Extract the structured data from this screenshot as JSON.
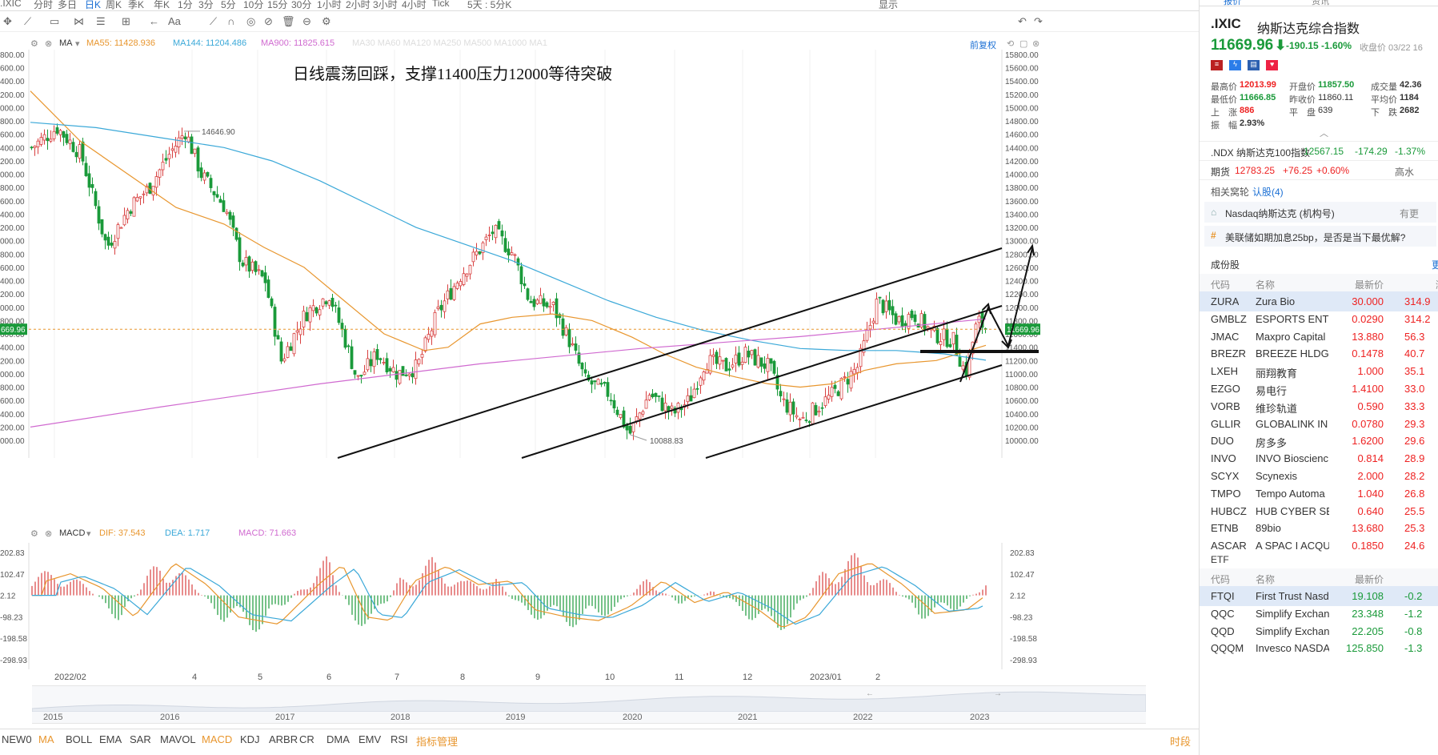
{
  "toolbar": {
    "items": [
      ".IXIC",
      "分时",
      "多日",
      "日K",
      "周K",
      "季K",
      "年K",
      "1分",
      "3分",
      "5分",
      "10分",
      "15分",
      "30分",
      "1小时",
      "2小时",
      "3小时",
      "4小时",
      "Tick",
      "5天 : 5分K"
    ],
    "right_label": "显示"
  },
  "ma_legend": {
    "title": "MA",
    "ma55": "MA55: 11428.936",
    "ma144": "MA144: 11204.486",
    "ma900": "MA900: 11825.615",
    "others": [
      "MA30",
      "MA60",
      "MA120",
      "MA250",
      "MA500",
      "MA1000",
      "MA1"
    ],
    "adjust": "前复权"
  },
  "annotation": "日线震荡回踩，支撑11400压力12000等待突破",
  "price_marks": {
    "high": "14646.90",
    "low": "10088.83",
    "current_left": "669.96",
    "current_right": "11669.96"
  },
  "left_axis": [
    "800.00",
    "600.00",
    "400.00",
    "200.00",
    "000.00",
    "800.00",
    "600.00",
    "400.00",
    "200.00",
    "000.00",
    "800.00",
    "600.00",
    "400.00",
    "200.00",
    "000.00",
    "800.00",
    "600.00",
    "400.00",
    "200.00",
    "000.00",
    "800.00",
    "600.00",
    "400.00",
    "200.00",
    "000.00",
    "800.00",
    "600.00",
    "400.00",
    "200.00",
    "000.00"
  ],
  "right_axis": [
    "15800.00",
    "15600.00",
    "15400.00",
    "15200.00",
    "15000.00",
    "14800.00",
    "14600.00",
    "14400.00",
    "14200.00",
    "14000.00",
    "13800.00",
    "13600.00",
    "13400.00",
    "13200.00",
    "13000.00",
    "12800.00",
    "12600.00",
    "12400.00",
    "12200.00",
    "12000.00",
    "11800.00",
    "11600.00",
    "11400.00",
    "11200.00",
    "11000.00",
    "10800.00",
    "10600.00",
    "10400.00",
    "10200.00",
    "10000.00"
  ],
  "macd_legend": {
    "title": "MACD",
    "dif": "DIF: 37.543",
    "dea": "DEA: 1.717",
    "macd": "MACD: 71.663"
  },
  "macd_axis_left": [
    "202.83",
    "102.47",
    "2.12",
    "-98.23",
    "-198.58",
    "-298.93"
  ],
  "macd_axis_right": [
    "202.83",
    "102.47",
    "2.12",
    "-98.23",
    "-198.58",
    "-298.93"
  ],
  "time_axis": [
    "2022/02",
    "4",
    "5",
    "6",
    "7",
    "8",
    "9",
    "10",
    "11",
    "12",
    "2023/01",
    "2"
  ],
  "overview_years": [
    "2015",
    "2016",
    "2017",
    "2018",
    "2019",
    "2020",
    "2021",
    "2022",
    "2023"
  ],
  "bottom_bar": {
    "items": [
      "NEW0",
      "MA",
      "BOLL",
      "EMA",
      "SAR",
      "MAVOL",
      "MACD",
      "KDJ",
      "ARBR",
      "CR",
      "DMA",
      "EMV",
      "RSI",
      "指标管理"
    ],
    "right": "时段"
  },
  "quote": {
    "tabs": [
      "报价",
      "资讯"
    ],
    "code": ".IXIC",
    "name": "纳斯达克综合指数",
    "price": "11669.96",
    "arrow": "⬇",
    "change": "-190.15",
    "change_pct": "-1.60%",
    "close_time": "收盘价 03/22 16",
    "stats": [
      {
        "label": "最高价",
        "value": "12013.99",
        "label2": "开盘价",
        "value2": "11857.50",
        "label3": "成交量",
        "value3": "42.36"
      },
      {
        "label": "最低价",
        "value": "11666.85",
        "label2": "昨收价",
        "value2": "11860.11",
        "label3": "平均价",
        "value3": "1184"
      },
      {
        "label": "上　涨",
        "value": "886",
        "label2": "平　盘",
        "value2": "639",
        "label3": "下　跌",
        "value3": "2682"
      },
      {
        "label": "振　幅",
        "value": "2.93%"
      }
    ],
    "ndx": {
      "name": ".NDX 纳斯达克100指数",
      "price": "12567.15",
      "change": "-174.29",
      "pct": "-1.37%"
    },
    "futures": {
      "label": "期货",
      "price": "12783.25",
      "change": "+76.25",
      "pct": "+0.60%",
      "extra": "高水"
    },
    "related": {
      "label": "相关窝轮",
      "link": "认股(4)"
    },
    "org": {
      "label": "Nasdaq纳斯达克 (机构号)",
      "extra": "有更"
    },
    "news": "美联储如期加息25bp，是否是当下最优解?"
  },
  "constituents": {
    "title": "成份股",
    "headers": [
      "代码",
      "名称",
      "最新价",
      "涨跌"
    ],
    "rows": [
      {
        "code": "ZURA",
        "name": "Zura Bio",
        "price": "30.000",
        "pct": "314.9"
      },
      {
        "code": "GMBLZ",
        "name": "ESPORTS ENTE",
        "price": "0.0290",
        "pct": "314.2"
      },
      {
        "code": "JMAC",
        "name": "Maxpro Capital",
        "price": "13.880",
        "pct": "56.3"
      },
      {
        "code": "BREZR",
        "name": "BREEZE HLDGS",
        "price": "0.1478",
        "pct": "40.7"
      },
      {
        "code": "LXEH",
        "name": "丽翔教育",
        "price": "1.000",
        "pct": "35.1"
      },
      {
        "code": "EZGO",
        "name": "易电行",
        "price": "1.4100",
        "pct": "33.0"
      },
      {
        "code": "VORB",
        "name": "维珍轨道",
        "price": "0.590",
        "pct": "33.3"
      },
      {
        "code": "GLLIR",
        "name": "GLOBALINK IN",
        "price": "0.0780",
        "pct": "29.3"
      },
      {
        "code": "DUO",
        "name": "房多多",
        "price": "1.6200",
        "pct": "29.6"
      },
      {
        "code": "INVO",
        "name": "INVO Bioscienc",
        "price": "0.814",
        "pct": "28.9"
      },
      {
        "code": "SCYX",
        "name": "Scynexis",
        "price": "2.000",
        "pct": "28.2"
      },
      {
        "code": "TMPO",
        "name": "Tempo Automa",
        "price": "1.040",
        "pct": "26.8"
      },
      {
        "code": "HUBCZ",
        "name": "HUB CYBER SE",
        "price": "0.640",
        "pct": "25.5"
      },
      {
        "code": "ETNB",
        "name": "89bio",
        "price": "13.680",
        "pct": "25.3"
      },
      {
        "code": "ASCAR",
        "name": "A SPAC I ACQU",
        "price": "0.1850",
        "pct": "24.6"
      }
    ]
  },
  "etf": {
    "title": "ETF",
    "headers": [
      "代码",
      "名称",
      "最新价",
      "涨"
    ],
    "rows": [
      {
        "code": "FTQI",
        "name": "First Trust Nasdaq",
        "price": "19.108",
        "pct": "-0.2"
      },
      {
        "code": "QQC",
        "name": "Simplify Exchange",
        "price": "23.348",
        "pct": "-1.2"
      },
      {
        "code": "QQD",
        "name": "Simplify Exchange",
        "price": "22.205",
        "pct": "-0.8"
      },
      {
        "code": "QQQM",
        "name": "Invesco NASDAQ",
        "price": "125.850",
        "pct": "-1.3"
      }
    ]
  },
  "colors": {
    "up": "#e22",
    "down": "#1a9a3a",
    "ma55": "#e8962e",
    "ma144": "#3aa8d8",
    "ma900": "#d06ad0",
    "accent": "#1a6fd4"
  }
}
